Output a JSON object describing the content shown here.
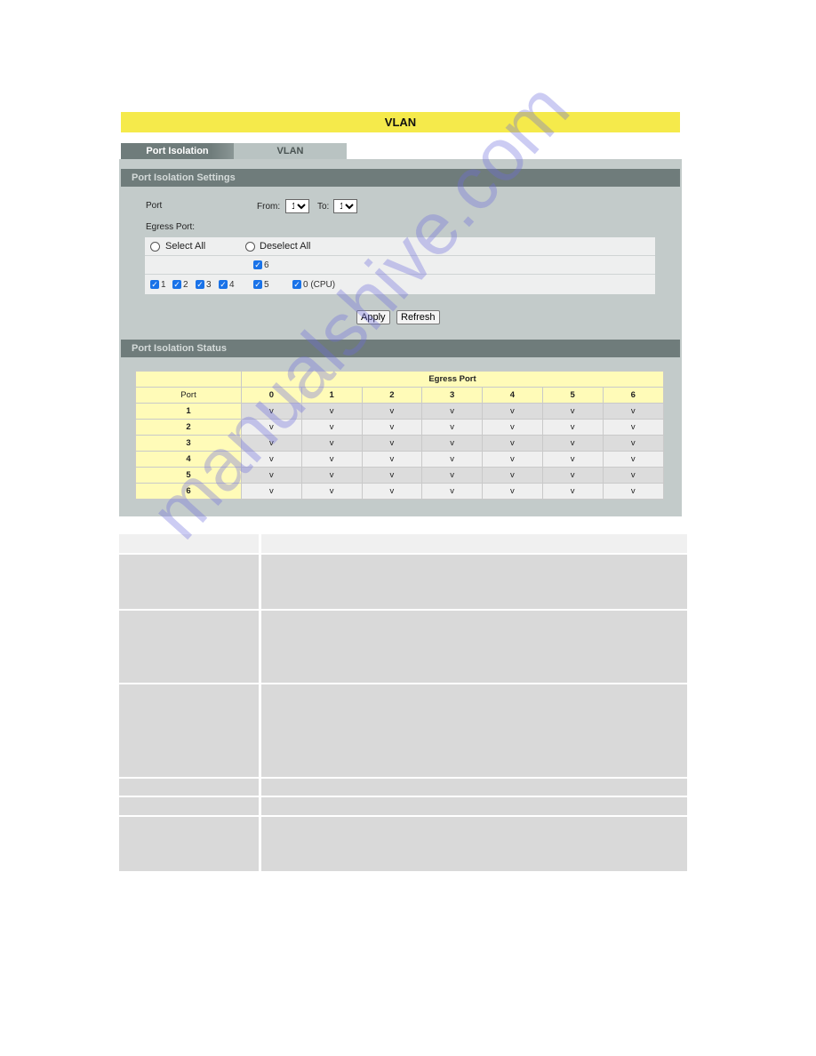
{
  "page": {
    "title": "VLAN",
    "tabs": [
      {
        "label": "Port Isolation",
        "active": true
      },
      {
        "label": "VLAN",
        "active": false
      }
    ]
  },
  "settings": {
    "section_title": "Port Isolation Settings",
    "port_label": "Port",
    "from_label": "From:",
    "from_value": "1",
    "to_label": "To:",
    "to_value": "1",
    "egress_label": "Egress Port:",
    "select_all_label": "Select All",
    "deselect_all_label": "Deselect All",
    "egress_ports": [
      {
        "label": "1",
        "checked": true
      },
      {
        "label": "2",
        "checked": true
      },
      {
        "label": "3",
        "checked": true
      },
      {
        "label": "4",
        "checked": true
      },
      {
        "label": "5",
        "checked": true
      },
      {
        "label": "0 (CPU)",
        "checked": true
      },
      {
        "label": "6",
        "checked": true
      }
    ],
    "apply_label": "Apply",
    "refresh_label": "Refresh"
  },
  "status": {
    "section_title": "Port Isolation Status",
    "egress_header": "Egress Port",
    "port_header": "Port",
    "columns": [
      "0",
      "1",
      "2",
      "3",
      "4",
      "5",
      "6"
    ],
    "rows": [
      {
        "port": "1",
        "values": [
          "v",
          "v",
          "v",
          "v",
          "v",
          "v",
          "v"
        ]
      },
      {
        "port": "2",
        "values": [
          "v",
          "v",
          "v",
          "v",
          "v",
          "v",
          "v"
        ]
      },
      {
        "port": "3",
        "values": [
          "v",
          "v",
          "v",
          "v",
          "v",
          "v",
          "v"
        ]
      },
      {
        "port": "4",
        "values": [
          "v",
          "v",
          "v",
          "v",
          "v",
          "v",
          "v"
        ]
      },
      {
        "port": "5",
        "values": [
          "v",
          "v",
          "v",
          "v",
          "v",
          "v",
          "v"
        ]
      },
      {
        "port": "6",
        "values": [
          "v",
          "v",
          "v",
          "v",
          "v",
          "v",
          "v"
        ]
      }
    ]
  },
  "watermark": "manualshive.com",
  "colors": {
    "banner": "#f5ea4b",
    "section_header": "#6f7c7b",
    "panel_bg": "#c3cbca",
    "table_header": "#fffbb8",
    "checkbox": "#1a73e8"
  }
}
